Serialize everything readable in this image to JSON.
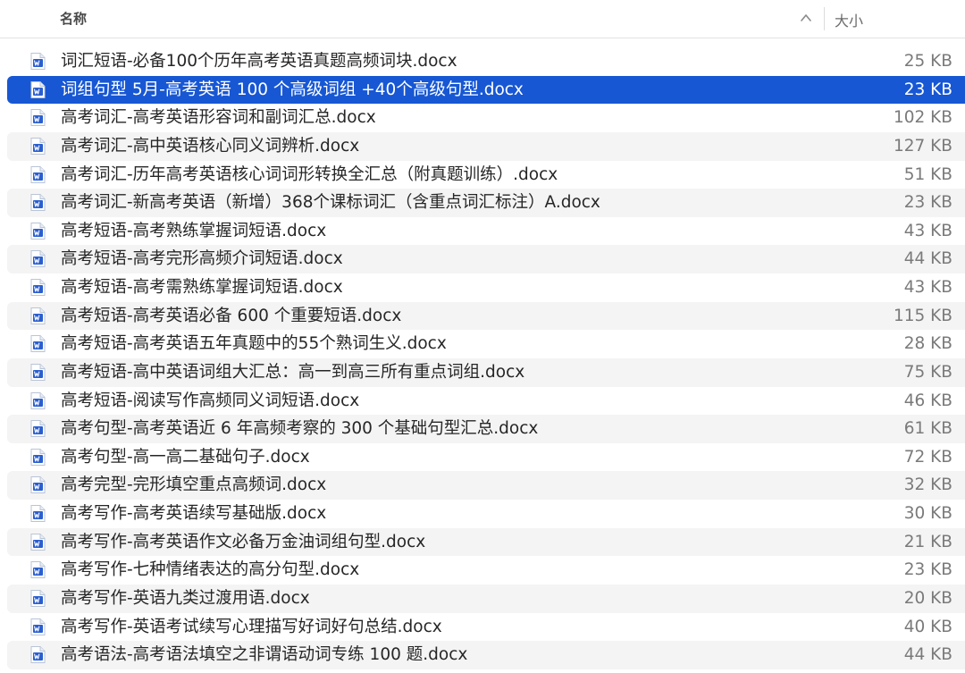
{
  "header": {
    "name_label": "名称",
    "size_label": "大小",
    "sort_icon": "chevron-up-icon"
  },
  "colors": {
    "selection": "#1757d4",
    "stripe": "#f4f4f4",
    "doc_icon_blue": "#2b5fcf"
  },
  "files": [
    {
      "name": "词汇短语-必备100个历年高考英语真题高频词块.docx",
      "size": "25 KB",
      "selected": false
    },
    {
      "name": "词组句型 5月-高考英语 100 个高级词组 +40个高级句型.docx",
      "size": "23 KB",
      "selected": true
    },
    {
      "name": "高考词汇-高考英语形容词和副词汇总.docx",
      "size": "102 KB",
      "selected": false
    },
    {
      "name": "高考词汇-高中英语核心同义词辨析.docx",
      "size": "127 KB",
      "selected": false
    },
    {
      "name": "高考词汇-历年高考英语核心词词形转换全汇总（附真题训练）.docx",
      "size": "51 KB",
      "selected": false
    },
    {
      "name": "高考词汇-新高考英语（新增）368个课标词汇（含重点词汇标注）A.docx",
      "size": "23 KB",
      "selected": false
    },
    {
      "name": "高考短语-高考熟练掌握词短语.docx",
      "size": "43 KB",
      "selected": false
    },
    {
      "name": "高考短语-高考完形高频介词短语.docx",
      "size": "44 KB",
      "selected": false
    },
    {
      "name": "高考短语-高考需熟练掌握词短语.docx",
      "size": "43 KB",
      "selected": false
    },
    {
      "name": "高考短语-高考英语必备 600 个重要短语.docx",
      "size": "115 KB",
      "selected": false
    },
    {
      "name": "高考短语-高考英语五年真题中的55个熟词生义.docx",
      "size": "28 KB",
      "selected": false
    },
    {
      "name": "高考短语-高中英语词组大汇总：高一到高三所有重点词组.docx",
      "size": "75 KB",
      "selected": false
    },
    {
      "name": "高考短语-阅读写作高频同义词短语.docx",
      "size": "46 KB",
      "selected": false
    },
    {
      "name": "高考句型-高考英语近 6 年高频考察的 300 个基础句型汇总.docx",
      "size": "61 KB",
      "selected": false
    },
    {
      "name": "高考句型-高一高二基础句子.docx",
      "size": "72 KB",
      "selected": false
    },
    {
      "name": "高考完型-完形填空重点高频词.docx",
      "size": "32 KB",
      "selected": false
    },
    {
      "name": "高考写作-高考英语续写基础版.docx",
      "size": "30 KB",
      "selected": false
    },
    {
      "name": "高考写作-高考英语作文必备万金油词组句型.docx",
      "size": "21 KB",
      "selected": false
    },
    {
      "name": "高考写作-七种情绪表达的高分句型.docx",
      "size": "23 KB",
      "selected": false
    },
    {
      "name": "高考写作-英语九类过渡用语.docx",
      "size": "20 KB",
      "selected": false
    },
    {
      "name": "高考写作-英语考试续写心理描写好词好句总结.docx",
      "size": "40 KB",
      "selected": false
    },
    {
      "name": "高考语法-高考语法填空之非谓语动词专练 100 题.docx",
      "size": "44 KB",
      "selected": false
    }
  ]
}
